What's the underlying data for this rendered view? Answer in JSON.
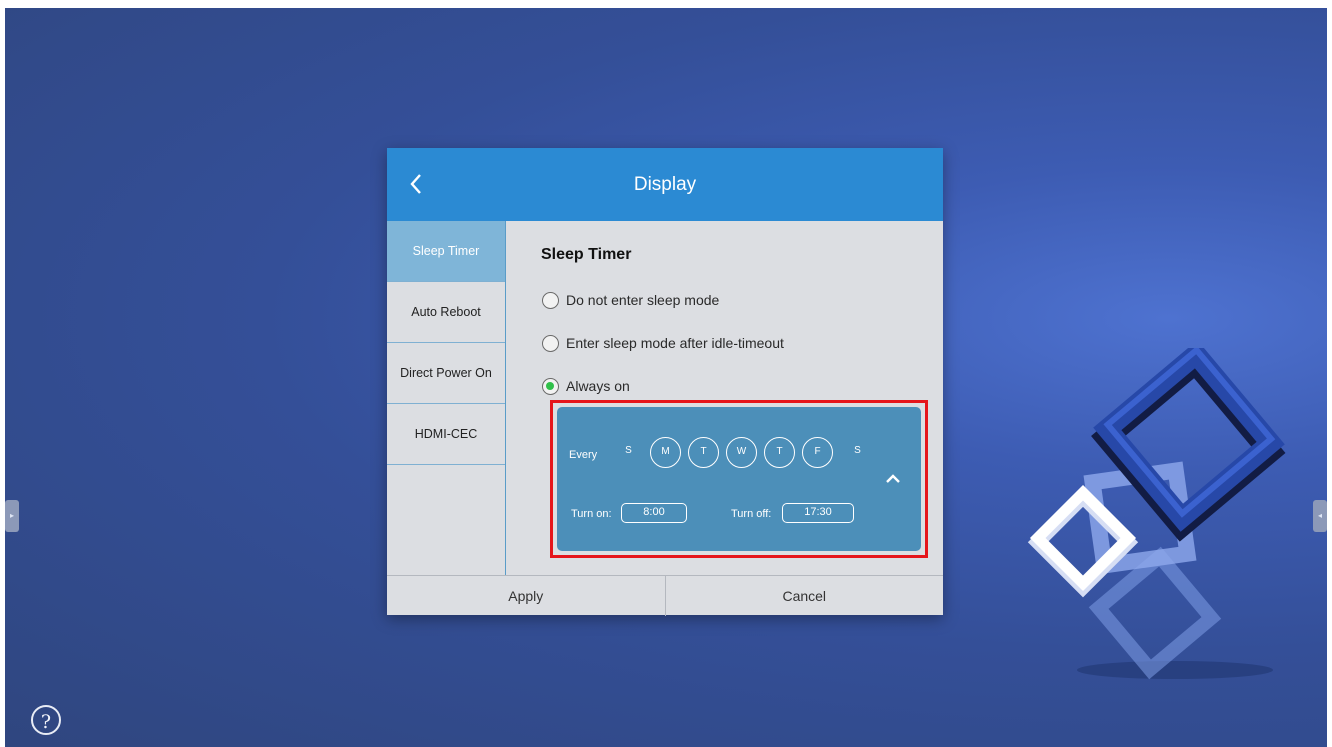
{
  "dialog": {
    "title": "Display",
    "back_icon": "chevron-left-icon"
  },
  "sidebar": {
    "items": [
      {
        "label": "Sleep Timer",
        "active": true
      },
      {
        "label": "Auto Reboot",
        "active": false
      },
      {
        "label": "Direct Power On",
        "active": false
      },
      {
        "label": "HDMI-CEC",
        "active": false
      }
    ]
  },
  "content": {
    "section_title": "Sleep Timer",
    "options": [
      {
        "label": "Do not enter sleep mode",
        "checked": false
      },
      {
        "label": "Enter sleep mode after idle-timeout",
        "checked": false
      },
      {
        "label": "Always on",
        "checked": true
      }
    ]
  },
  "schedule": {
    "every_label": "Every",
    "days": [
      {
        "label": "S",
        "selected": false
      },
      {
        "label": "M",
        "selected": true
      },
      {
        "label": "T",
        "selected": true
      },
      {
        "label": "W",
        "selected": true
      },
      {
        "label": "T",
        "selected": true
      },
      {
        "label": "F",
        "selected": true
      },
      {
        "label": "S",
        "selected": false
      }
    ],
    "turn_on_label": "Turn on:",
    "turn_on_value": "8:00",
    "turn_off_label": "Turn off:",
    "turn_off_value": "17:30",
    "collapse_icon": "chevron-up-icon",
    "highlight_color": "#e5151b"
  },
  "footer": {
    "apply_label": "Apply",
    "cancel_label": "Cancel"
  },
  "screen": {
    "help_label": "?",
    "left_tab_glyph": "▸",
    "right_tab_glyph": "◂",
    "accent_color": "#2b8ad3",
    "radio_checked_color": "#30c04a"
  }
}
